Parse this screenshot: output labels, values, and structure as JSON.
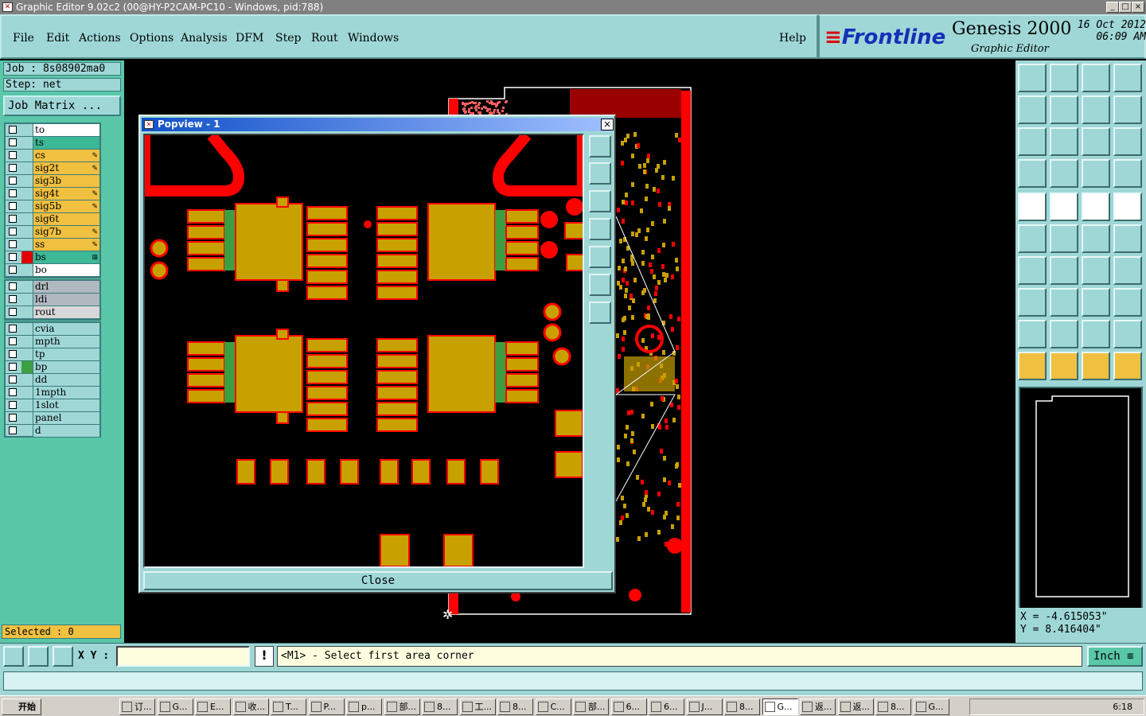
{
  "window": {
    "title": "Graphic Editor 9.02c2 (00@HY-P2CAM-PC10 - Windows, pid:788)",
    "min": "_",
    "max": "□",
    "close": "×"
  },
  "menu": {
    "items": [
      "File",
      "Edit",
      "Actions",
      "Options",
      "Analysis",
      "DFM",
      "Step",
      "Rout",
      "Windows"
    ],
    "help": "Help"
  },
  "brand": {
    "logo": "Frontline",
    "product": "Genesis 2000",
    "subtitle": "Graphic Editor",
    "date": "16 Oct 2012",
    "time": "06:09 AM"
  },
  "job": {
    "job_line": "Job : 8s08902ma0",
    "step_line": "Step: net",
    "matrix_button": "Job Matrix ..."
  },
  "layers_group1": [
    {
      "name": "to",
      "color": "#ffffff",
      "swatch": "",
      "mark": ""
    },
    {
      "name": "ts",
      "color": "#3cb896",
      "swatch": "",
      "mark": ""
    },
    {
      "name": "cs",
      "color": "#f0c040",
      "swatch": "",
      "mark": "✎"
    },
    {
      "name": "sig2t",
      "color": "#f0c040",
      "swatch": "",
      "mark": "✎"
    },
    {
      "name": "sig3b",
      "color": "#f0c040",
      "swatch": "",
      "mark": ""
    },
    {
      "name": "sig4t",
      "color": "#f0c040",
      "swatch": "",
      "mark": "✎"
    },
    {
      "name": "sig5b",
      "color": "#f0c040",
      "swatch": "",
      "mark": "✎"
    },
    {
      "name": "sig6t",
      "color": "#f0c040",
      "swatch": "",
      "mark": ""
    },
    {
      "name": "sig7b",
      "color": "#f0c040",
      "swatch": "",
      "mark": "✎"
    },
    {
      "name": "ss",
      "color": "#f0c040",
      "swatch": "",
      "mark": "✎"
    },
    {
      "name": "bs",
      "color": "#3cb896",
      "swatch": "#e00000",
      "mark": "⊞"
    },
    {
      "name": "bo",
      "color": "#ffffff",
      "swatch": "",
      "mark": ""
    }
  ],
  "layers_group2": [
    {
      "name": "drl",
      "color": "#b0b8c0"
    },
    {
      "name": "ldi",
      "color": "#b0b8c0"
    },
    {
      "name": "rout",
      "color": "#d8d8d8"
    }
  ],
  "layers_group3": [
    {
      "name": "cvia",
      "color": "#9fd7d7",
      "swatch": ""
    },
    {
      "name": "mpth",
      "color": "#9fd7d7",
      "swatch": ""
    },
    {
      "name": "tp",
      "color": "#9fd7d7",
      "swatch": ""
    },
    {
      "name": "bp",
      "color": "#9fd7d7",
      "swatch": "#3ca040"
    },
    {
      "name": "dd",
      "color": "#9fd7d7",
      "swatch": ""
    },
    {
      "name": "1mpth",
      "color": "#9fd7d7",
      "swatch": ""
    },
    {
      "name": "1slot",
      "color": "#9fd7d7",
      "swatch": ""
    },
    {
      "name": "panel",
      "color": "#9fd7d7",
      "swatch": ""
    },
    {
      "name": "d",
      "color": "#9fd7d7",
      "swatch": ""
    }
  ],
  "selected": "Selected : 0",
  "popview": {
    "title": "Popview - 1",
    "close_x": "×",
    "close_button": "Close"
  },
  "coords": {
    "x": "X = -4.615053\"",
    "y": "Y = 8.416404\""
  },
  "cmdbar": {
    "xy_label": "X Y :",
    "xy_value": "",
    "excl": "!",
    "prompt": "<M1> - Select first area corner",
    "units": "Inch ≡"
  },
  "taskbar": {
    "start": "开始",
    "tasks": [
      "订...",
      "G...",
      "E...",
      "收...",
      "T...",
      "P...",
      "p...",
      "部...",
      "8...",
      "工...",
      "8...",
      "C...",
      "部...",
      "6...",
      "6...",
      "J...",
      "8...",
      "G...",
      "返...",
      "返...",
      "8...",
      "G..."
    ],
    "clock": "6:18"
  },
  "colors": {
    "panel": "#9fd7d7",
    "green_panel": "#59c7a8",
    "copper_red": "#ff0000",
    "pad_gold": "#c8a000"
  }
}
